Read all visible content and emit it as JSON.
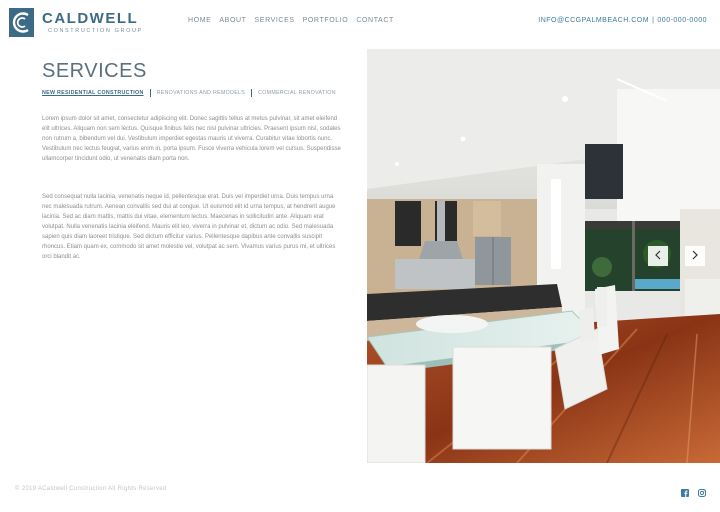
{
  "brand": {
    "title": "CALDWELL",
    "subtitle": "CONSTRUCTION GROUP",
    "color": "#3d6a85"
  },
  "nav": {
    "items": [
      {
        "label": "HOME"
      },
      {
        "label": "ABOUT"
      },
      {
        "label": "SERVICES"
      },
      {
        "label": "PORTFOLIO"
      },
      {
        "label": "CONTACT"
      }
    ]
  },
  "contact": {
    "email": "INFO@CCGPALMBEACH.COM",
    "separator": "|",
    "phone": "000-000-0000"
  },
  "main": {
    "title": "SERVICES",
    "tabs": [
      {
        "label": "NEW RESIDENTIAL CONSTRUCTION",
        "active": true
      },
      {
        "label": "RENOVATIONS AND REMODELS",
        "active": false
      },
      {
        "label": "COMMERCIAL RENOVATION",
        "active": false
      }
    ],
    "paragraph1": "Lorem ipsum dolor sit amet, consectetur adipiscing elit. Donec sagittis tellus at metus pulvinar, sit amet eleifend elit ultrices. Aliquam non sem lectus. Quisque finibus felis nec nisl pulvinar ultricies. Praesent ipsum nisl, sodales non rutrum a, bibendum vel dui. Vestibulum imperdiet egestas mauris ut viverra. Curabitur vitae lobortis nunc. Vestibulum nec lectus feugiat, varius enim in, porta ipsum. Fusce viverra vehicula lorem vel cursus. Suspendisse ullamcorper tincidunt odio, ut venenatis diam porta non.",
    "paragraph2": "Sed consequat nulla lacinia, venenatis neque id, pellentesque erat. Duis vel imperdiet urna. Duis tempus urna nec malesuada rutrum. Aenean convallis sed dui at congue. Ut euismod elit id urna tempus, at hendrerit augue lacinia. Sed ac diam mattis, mattis dui vitae, elementum lectus. Maecenas in sollicitudin ante. Aliquam erat volutpat. Nulla venenatis lacinia eleifend. Mauris elit leo, viverra in pulvinar et, dictum ac odio. Sed malesuada sapien quis diam laoreet tristique. Sed dictum efficitur varius. Pellentesque dapibus ante convallis suscipit rhoncus. Etiam quam ex, commodo sit amet molestie vel, volutpat ac sem. Vivamus varius purus mi, et ultrices orci blandit ac."
  },
  "slider": {
    "prev_icon": "chevron-left-icon",
    "next_icon": "chevron-right-icon"
  },
  "footer": {
    "copyright": "© 2019 ACaldwell Construction    All Rights Reserved",
    "social": [
      "facebook-icon",
      "instagram-icon"
    ],
    "social_color": "#3c7ba3"
  }
}
